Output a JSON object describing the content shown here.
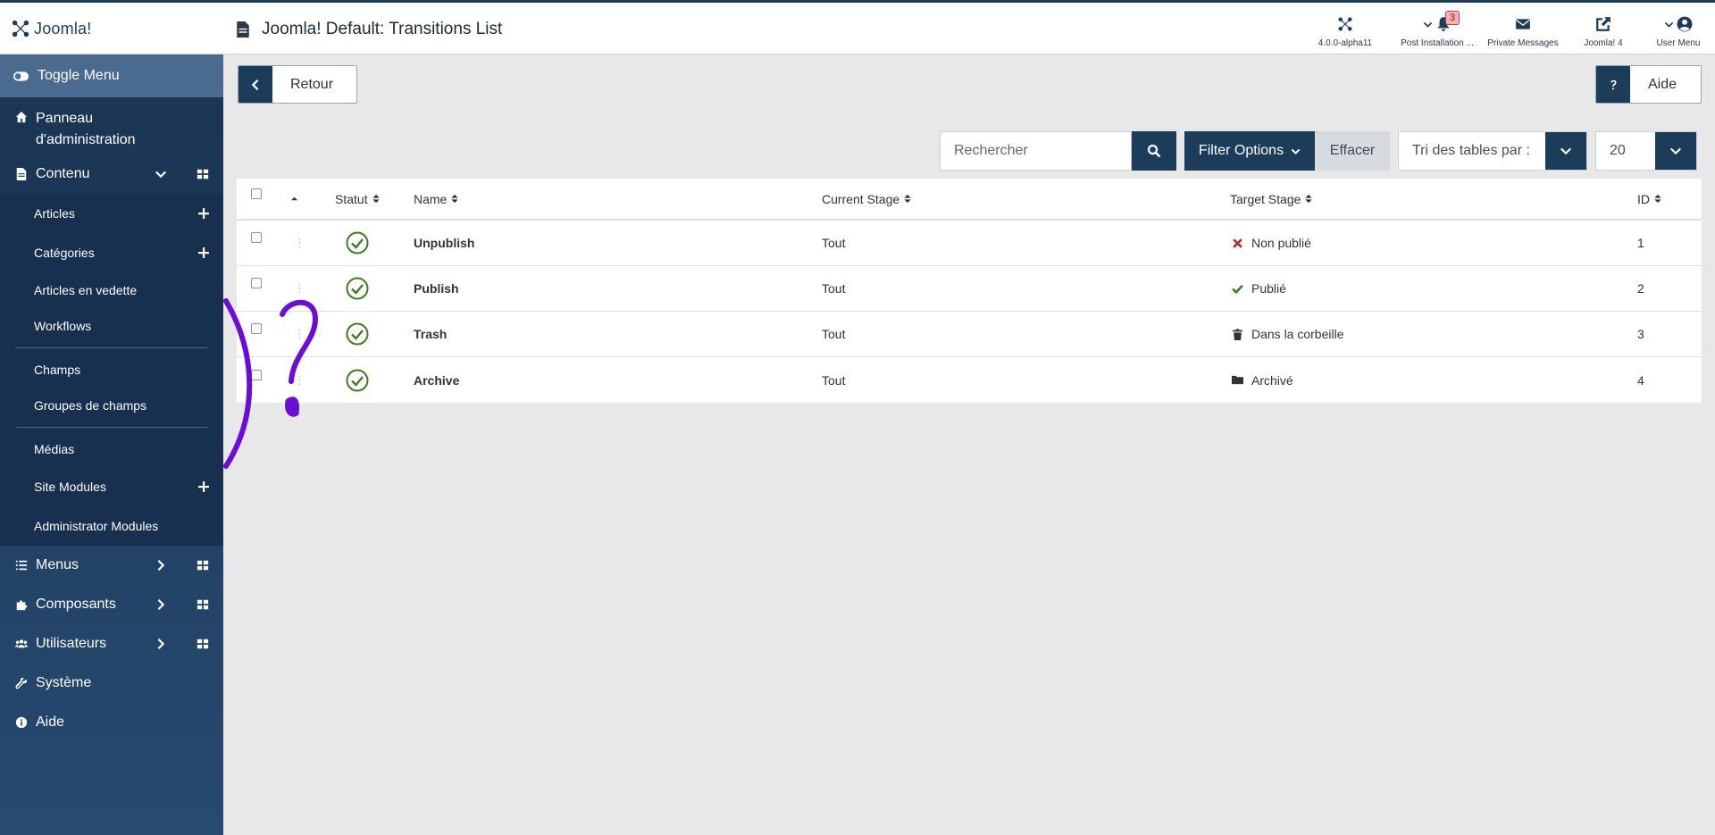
{
  "app": {
    "logo_text": "Joomla!",
    "title": "Joomla! Default: Transitions List"
  },
  "header": {
    "items": [
      {
        "label": "4.0.0-alpha11",
        "icon": "joomla-icon"
      },
      {
        "label": "Post Installation ...",
        "icon": "bell-icon",
        "badge": "3"
      },
      {
        "label": "Private Messages",
        "icon": "envelope-icon"
      },
      {
        "label": "Joomla! 4",
        "icon": "external-link-icon"
      },
      {
        "label": "User Menu",
        "icon": "user-circle-icon"
      }
    ]
  },
  "sidebar": {
    "toggle": "Toggle Menu",
    "panel": "Panneau d'administration",
    "contenu": "Contenu",
    "sub": [
      "Articles",
      "Catégories",
      "Articles en vedette",
      "Workflows",
      "Champs",
      "Groupes de champs",
      "Médias",
      "Site Modules",
      "Administrator Modules"
    ],
    "menus": "Menus",
    "composants": "Composants",
    "utilisateurs": "Utilisateurs",
    "systeme": "Système",
    "aide": "Aide"
  },
  "toolbar": {
    "back": "Retour",
    "help": "Aide"
  },
  "filters": {
    "search_placeholder": "Rechercher",
    "filter_options": "Filter Options",
    "clear": "Effacer",
    "sort": "Tri des tables par :",
    "limit": "20"
  },
  "table": {
    "headers": {
      "status": "Statut",
      "name": "Name",
      "current": "Current Stage",
      "target": "Target Stage",
      "id": "ID"
    },
    "rows": [
      {
        "name": "Unpublish",
        "current": "Tout",
        "target": "Non publié",
        "target_icon": "times-icon",
        "id": "1"
      },
      {
        "name": "Publish",
        "current": "Tout",
        "target": "Publié",
        "target_icon": "check-icon",
        "id": "2"
      },
      {
        "name": "Trash",
        "current": "Tout",
        "target": "Dans la corbeille",
        "target_icon": "trash-icon",
        "id": "3"
      },
      {
        "name": "Archive",
        "current": "Tout",
        "target": "Archivé",
        "target_icon": "folder-icon",
        "id": "4"
      }
    ]
  },
  "colors": {
    "brand": "#1c3d5a",
    "sidebar_active": "#4a6a90",
    "success": "#3f7d20",
    "danger": "#b52a2f",
    "annotation": "#6a0dd8"
  }
}
